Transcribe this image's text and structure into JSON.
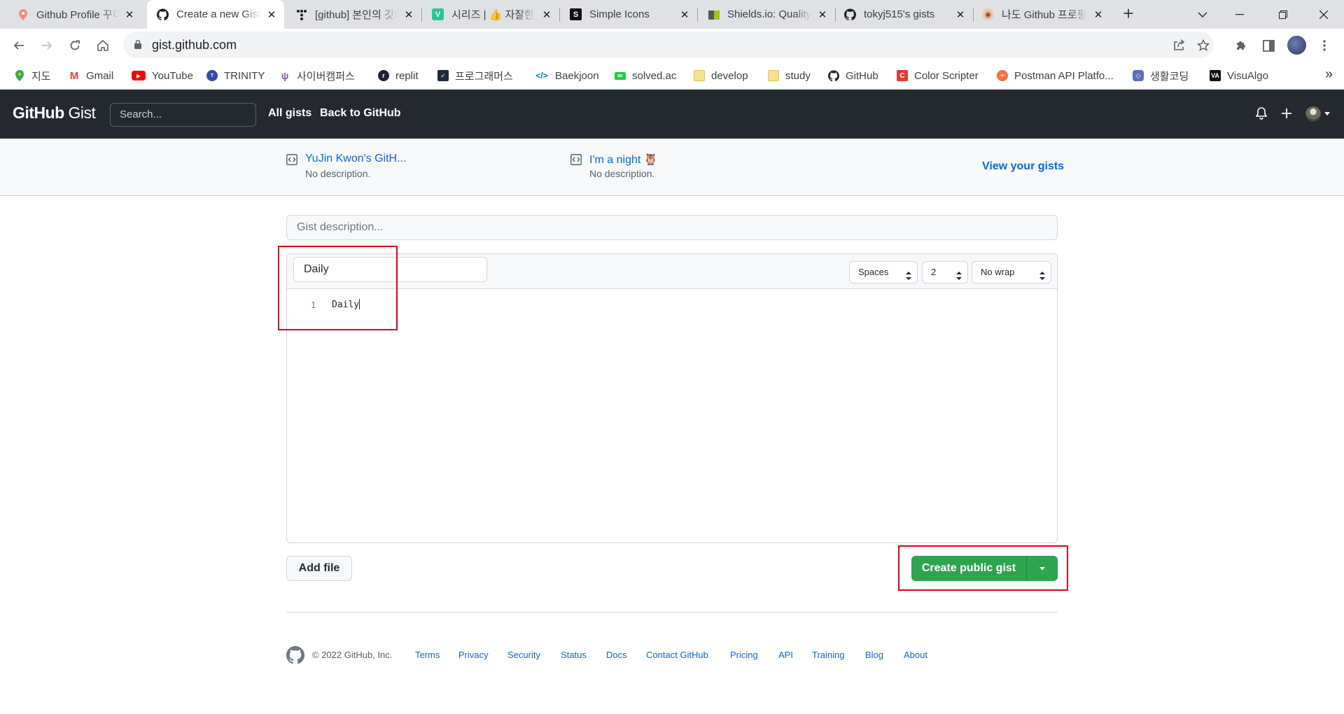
{
  "browser": {
    "tabs": [
      {
        "title": "Github Profile 꾸미기",
        "icon": "map-pin-icon",
        "active": false
      },
      {
        "title": "Create a new Gist",
        "icon": "github-icon",
        "active": true
      },
      {
        "title": "[github] 본인의 깃허브",
        "icon": "dots-icon",
        "active": false
      },
      {
        "title": "시리즈 | 👍 자잘한",
        "icon": "velog-icon",
        "active": false
      },
      {
        "title": "Simple Icons",
        "icon": "simpleicons-icon",
        "active": false
      },
      {
        "title": "Shields.io: Quality",
        "icon": "shields-icon",
        "active": false
      },
      {
        "title": "tokyj515's gists",
        "icon": "github-icon",
        "active": false
      },
      {
        "title": "나도 Github 프로필",
        "icon": "owl-icon",
        "active": false
      }
    ],
    "url": "gist.github.com",
    "bookmarks": [
      {
        "label": "지도",
        "icon": "maps-icon",
        "color": "#34a853"
      },
      {
        "label": "Gmail",
        "icon": "gmail-icon",
        "color": "#ea4335"
      },
      {
        "label": "YouTube",
        "icon": "youtube-icon",
        "color": "#ff0000"
      },
      {
        "label": "TRINITY",
        "icon": "trinity-icon",
        "color": "#3949ab"
      },
      {
        "label": "사이버캠퍼스",
        "icon": "cybercampus-icon",
        "color": "#7e57c2"
      },
      {
        "label": "replit",
        "icon": "replit-icon",
        "color": "#1c2333"
      },
      {
        "label": "프로그래머스",
        "icon": "programmers-icon",
        "color": "#1f2a3c"
      },
      {
        "label": "Baekjoon",
        "icon": "code-brackets-icon",
        "color": "#0076c0"
      },
      {
        "label": "solved.ac",
        "icon": "solvedac-icon",
        "color": "#17ce3a"
      },
      {
        "label": "develop",
        "icon": "folder-icon",
        "color": "#f9e08b"
      },
      {
        "label": "study",
        "icon": "folder-icon",
        "color": "#f9e08b"
      },
      {
        "label": "GitHub",
        "icon": "github-icon",
        "color": "#24292f"
      },
      {
        "label": "Color Scripter",
        "icon": "colorscripter-icon",
        "color": "#e53935"
      },
      {
        "label": "Postman API Platfo...",
        "icon": "postman-icon",
        "color": "#ff6c37"
      },
      {
        "label": "생활코딩",
        "icon": "opentutorials-icon",
        "color": "#5c6bc0"
      },
      {
        "label": "VisuAlgo",
        "icon": "visualgo-icon",
        "color": "#111111"
      }
    ]
  },
  "gist_header": {
    "logo_github": "GitHub",
    "logo_gist": "Gist",
    "search_placeholder": "Search...",
    "nav": [
      "All gists",
      "Back to GitHub"
    ]
  },
  "recent_gists": [
    {
      "title": "YuJin Kwon's GitH...",
      "description": "No description."
    },
    {
      "title": "I'm a night 🦉",
      "description": "No description."
    }
  ],
  "view_your_gists": "View your gists",
  "form": {
    "description_placeholder": "Gist description...",
    "filename": "Daily",
    "indent_mode": "Spaces",
    "indent_size": "2",
    "wrap_mode": "No wrap",
    "code_lines": [
      {
        "number": "1",
        "text": "Daily"
      }
    ],
    "add_file_label": "Add file",
    "create_label": "Create public gist"
  },
  "footer": {
    "copyright": "© 2022 GitHub, Inc.",
    "links": [
      "Terms",
      "Privacy",
      "Security",
      "Status",
      "Docs",
      "Contact GitHub",
      "Pricing",
      "API",
      "Training",
      "Blog",
      "About"
    ]
  },
  "colors": {
    "header_bg": "#24292f",
    "link_blue": "#0969da",
    "create_green": "#2da44e",
    "annotation_red": "#e0001a"
  }
}
